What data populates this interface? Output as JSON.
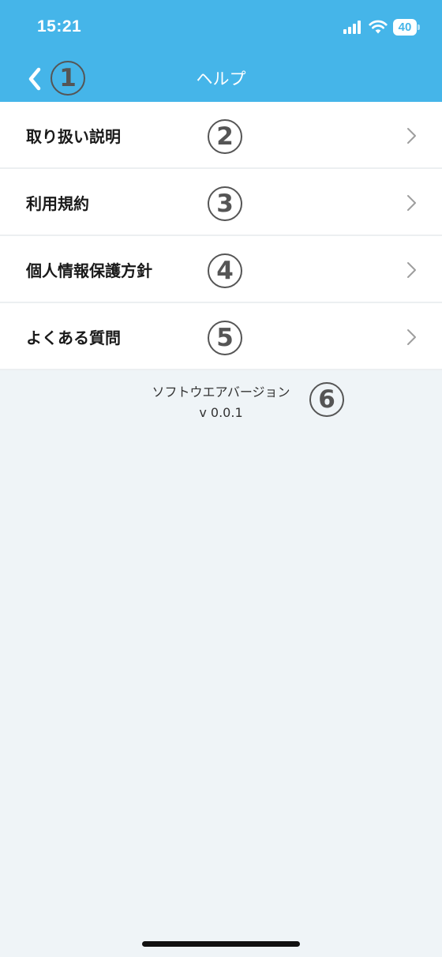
{
  "status_bar": {
    "time": "15:21",
    "battery": "40"
  },
  "header": {
    "title": "ヘルプ",
    "back_icon": "chevron-left-icon",
    "color": "#45b5e9"
  },
  "callouts": [
    "①",
    "②",
    "③",
    "④",
    "⑤",
    "⑥"
  ],
  "menu": {
    "items": [
      {
        "label": "取り扱い説明",
        "callout": "2"
      },
      {
        "label": "利用規約",
        "callout": "3"
      },
      {
        "label": "個人情報保護方針",
        "callout": "4"
      },
      {
        "label": "よくある質問",
        "callout": "5"
      }
    ]
  },
  "version": {
    "label": "ソフトウエアバージョン",
    "value": "v 0.0.1",
    "callout": "6"
  }
}
